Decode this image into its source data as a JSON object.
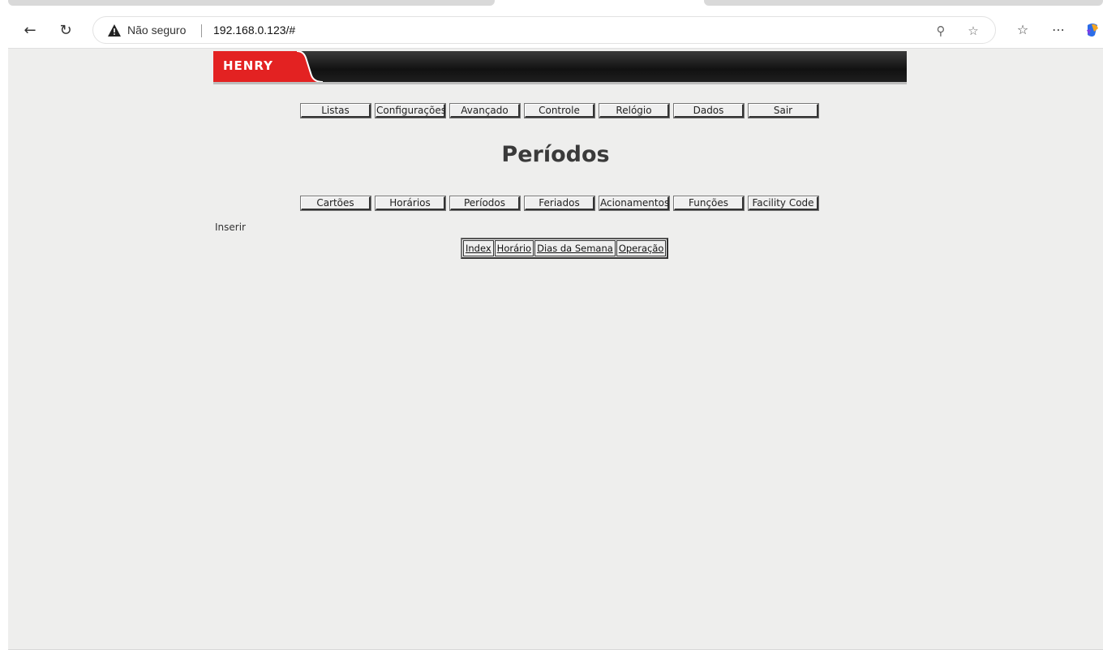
{
  "browser": {
    "security_label": "Não seguro",
    "url": "192.168.0.123/#"
  },
  "brand": {
    "logo_text": "HENRY",
    "accent": "#e32222"
  },
  "main_menu": [
    "Listas",
    "Configurações",
    "Avançado",
    "Controle",
    "Relógio",
    "Dados",
    "Sair"
  ],
  "page_title": "Períodos",
  "sub_menu": [
    "Cartões",
    "Horários",
    "Períodos",
    "Feriados",
    "Acionamentos",
    "Funções",
    "Facility Code"
  ],
  "insert_link": "Inserir",
  "table": {
    "columns": [
      "Index",
      "Horário",
      "Dias da Semana",
      "Operação"
    ]
  }
}
